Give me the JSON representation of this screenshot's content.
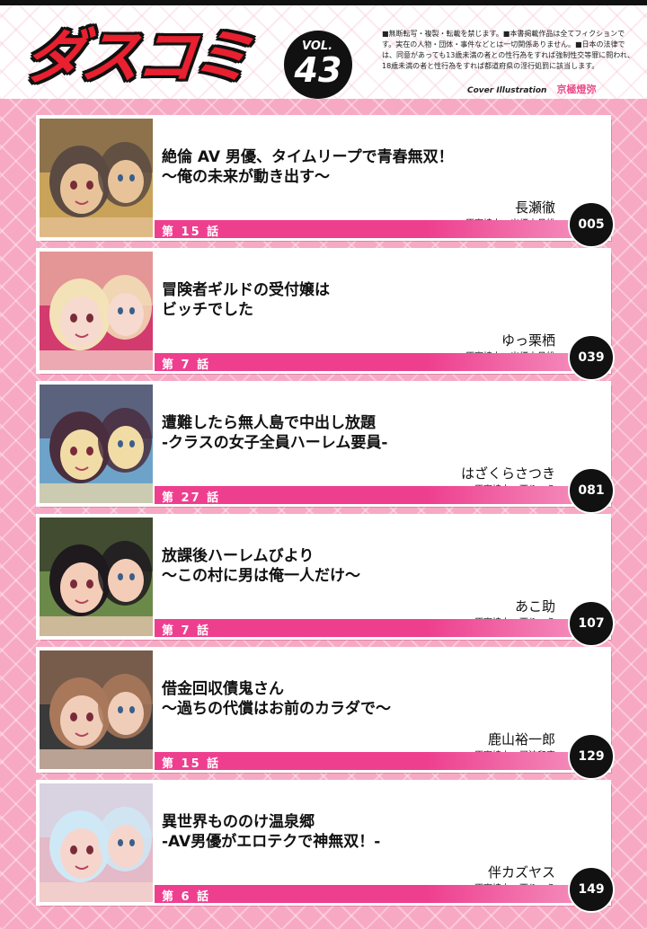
{
  "header": {
    "logo": "ダスコミ",
    "vol_label": "VOL.",
    "vol_number": "43",
    "notice": "■無断転写・複製・転載を禁じます。■本書掲載作品は全てフィクションです。実在の人物・団体・事件などとは一切関係ありません。■日本の法律では、同意があっても13歳未満の者との性行為をすれば強制性交等罪に問われ、18歳未満の者と性行為をすれば都道府県の淫行処罰に該当します。",
    "cover_label": "Cover Illustration",
    "cover_artist": "京極燈弥"
  },
  "stories": [
    {
      "title1": "絶倫 AV 男優、タイムリープで青春無双！",
      "title2": "〜俺の未来が動き出す〜",
      "author": "長瀬徹",
      "collab": "原案協力：出栖土呂維",
      "episode": "第 15 話",
      "page": "005",
      "art_colors": [
        "#5b4a42",
        "#e8c39a",
        "#c9a35a"
      ]
    },
    {
      "title1": "冒険者ギルドの受付嬢は",
      "title2": "ビッチでした",
      "author": "ゆっ栗栖",
      "collab": "原案協力：出栖土呂維",
      "episode": "第 7 話",
      "page": "039",
      "art_colors": [
        "#f3e2b8",
        "#f6d9cf",
        "#d33a6e"
      ]
    },
    {
      "title1": "遭難したら無人島で中出し放題",
      "title2": "-クラスの女子全員ハーレム要員-",
      "author": "はざくらさつき",
      "collab": "原案協力：西りょう",
      "episode": "第 27 話",
      "page": "081",
      "art_colors": [
        "#4a2e3e",
        "#f1dca6",
        "#6ea3c9"
      ]
    },
    {
      "title1": "放課後ハーレムびより",
      "title2": "〜この村に男は俺一人だけ〜",
      "author": "あこ助",
      "collab": "原案協力：西りょう",
      "episode": "第 7 話",
      "page": "107",
      "art_colors": [
        "#1f1a1e",
        "#f3cdb8",
        "#6b8a4a"
      ]
    },
    {
      "title1": "借金回収債鬼さん",
      "title2": "〜過ちの代償はお前のカラダで〜",
      "author": "鹿山裕一郎",
      "collab": "原案協力：司波和宏",
      "episode": "第 15 話",
      "page": "129",
      "art_colors": [
        "#a9785a",
        "#f0cdb9",
        "#3a3a3a"
      ]
    },
    {
      "title1": "異世界もののけ温泉郷",
      "title2": "-AV男優がエロテクで神無双！-",
      "author": "伴カズヤス",
      "collab": "原案協力：西りょう",
      "episode": "第 6 話",
      "page": "149",
      "art_colors": [
        "#cfe8f5",
        "#f6d6cc",
        "#e4b9c8"
      ]
    }
  ]
}
